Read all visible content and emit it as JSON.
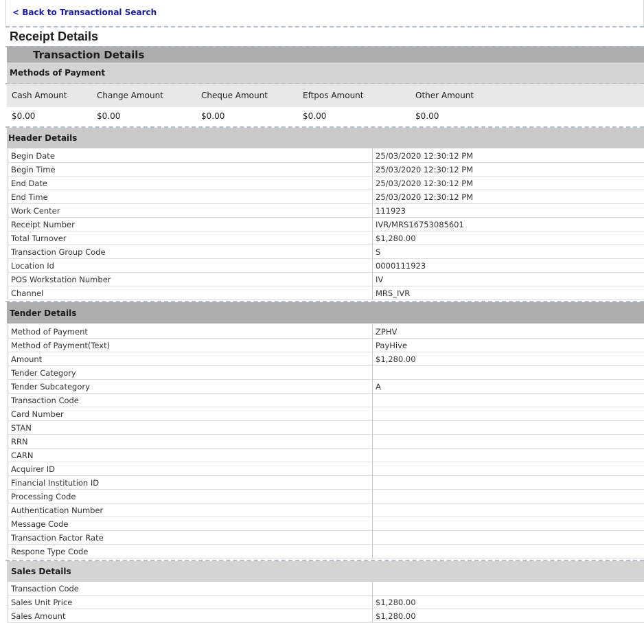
{
  "nav": {
    "back_label": "< Back to Transactional Search"
  },
  "page_title": "Receipt Details",
  "transaction_title": "Transaction Details",
  "methods_of_payment": {
    "title": "Methods of Payment",
    "columns": [
      "Cash Amount",
      "Change Amount",
      "Cheque Amount",
      "Eftpos Amount",
      "Other Amount"
    ],
    "values": [
      "$0.00",
      "$0.00",
      "$0.00",
      "$0.00",
      "$0.00"
    ]
  },
  "header_details": {
    "title": "Header Details",
    "rows": [
      [
        "Begin Date",
        "25/03/2020 12:30:12 PM"
      ],
      [
        "Begin Time",
        "25/03/2020 12:30:12 PM"
      ],
      [
        "End Date",
        "25/03/2020 12:30:12 PM"
      ],
      [
        "End Time",
        "25/03/2020 12:30:12 PM"
      ],
      [
        "Work Center",
        "111923"
      ],
      [
        "Receipt Number",
        "IVR/MRS16753085601"
      ],
      [
        "Total Turnover",
        "$1,280.00"
      ],
      [
        "Transaction Group Code",
        "S"
      ],
      [
        "Location Id",
        "0000111923"
      ],
      [
        "POS Workstation Number",
        "IV"
      ],
      [
        "Channel",
        "MRS_IVR"
      ]
    ]
  },
  "tender_details": {
    "title": "Tender Details",
    "rows": [
      [
        "Method of Payment",
        "ZPHV"
      ],
      [
        "Method of Payment(Text)",
        "PayHive"
      ],
      [
        "Amount",
        "$1,280.00"
      ],
      [
        "Tender Category",
        ""
      ],
      [
        "Tender Subcategory",
        "A"
      ],
      [
        "Transaction Code",
        ""
      ],
      [
        "Card Number",
        ""
      ],
      [
        "STAN",
        ""
      ],
      [
        "RRN",
        ""
      ],
      [
        "CARN",
        ""
      ],
      [
        "Acquirer ID",
        ""
      ],
      [
        "Financial Institution ID",
        ""
      ],
      [
        "Processing Code",
        ""
      ],
      [
        "Authentication Number",
        ""
      ],
      [
        "Message Code",
        ""
      ],
      [
        "Transaction Factor Rate",
        ""
      ],
      [
        "Respone Type Code",
        ""
      ]
    ]
  },
  "sales_details": {
    "title": "Sales Details",
    "rows": [
      [
        "Transaction Code",
        ""
      ],
      [
        "Sales Unit Price",
        "$1,280.00"
      ],
      [
        "Sales Amount",
        "$1,280.00"
      ]
    ]
  }
}
